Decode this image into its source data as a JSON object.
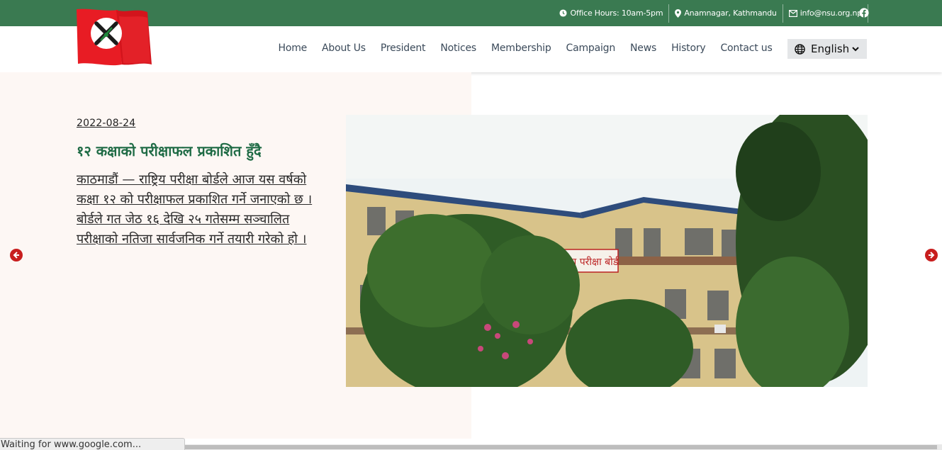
{
  "topbar": {
    "office_hours": "Office Hours: 10am-5pm",
    "address": "Anamnagar, Kathmandu",
    "email": "info@nsu.org.np",
    "social_icon": "facebook-icon"
  },
  "nav": {
    "items": [
      "Home",
      "About Us",
      "President",
      "Notices",
      "Membership",
      "Campaign",
      "News",
      "History",
      "Contact us"
    ]
  },
  "language": {
    "selected": "English"
  },
  "slide": {
    "date": "2022-08-24",
    "title": "१२ कक्षाको परीक्षाफल प्रकाशित हुँदै",
    "body": "काठमाडौं — राष्ट्रिय परीक्षा बोर्डले आज यस वर्षको कक्षा १२ को परीक्षाफल प्रकाशित गर्ने जनाएको छ । बोर्डले गत जेठ १६ देखि २५ गतेसम्म सञ्चालित परीक्षाको नतिजा सार्वजनिक गर्ने तयारी गरेको हो ।",
    "image_sign": "राष्ट्रिय परीक्षा बोर्ड"
  },
  "status_bar": {
    "text": "Waiting for www.google.com..."
  },
  "colors": {
    "brand_green": "#3a7a51",
    "title_green": "#1f6b45",
    "arrow_red": "#c81e1e",
    "flag_red": "#e81c24"
  }
}
